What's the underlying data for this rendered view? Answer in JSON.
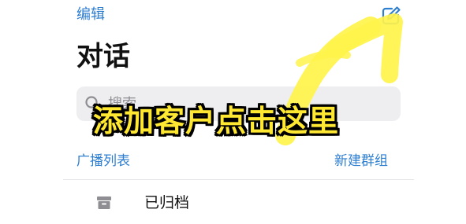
{
  "header": {
    "edit_label": "编辑",
    "compose_icon": "compose-icon",
    "title": "对话"
  },
  "search": {
    "placeholder": "搜索",
    "icon": "search-icon"
  },
  "links": {
    "broadcast_lists": "广播列表",
    "new_group": "新建群组"
  },
  "archived": {
    "icon": "archive-icon",
    "label": "已归档"
  },
  "annotation": {
    "banner_text": "添加客户点击这里",
    "arrow_icon": "pointer-arrow",
    "banner_color": "#ffe832"
  },
  "colors": {
    "accent": "#2f7fd0",
    "search_bg": "#eeeef0",
    "annotation_yellow": "#fff34a"
  }
}
